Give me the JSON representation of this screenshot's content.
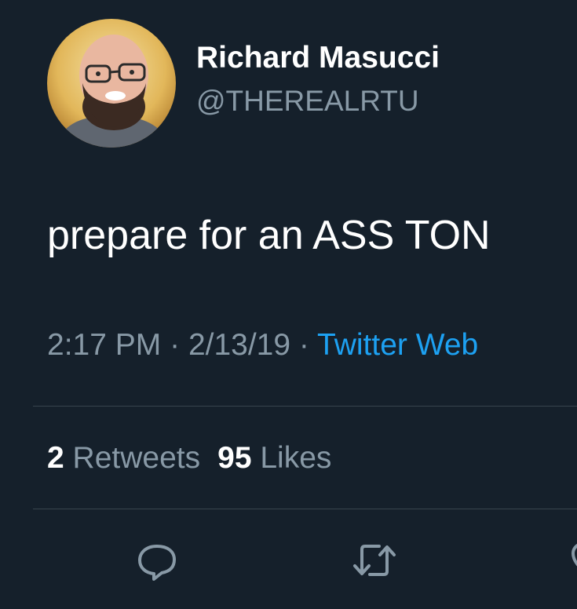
{
  "author": {
    "display_name": "Richard Masucci",
    "handle": "@THEREALRTU"
  },
  "tweet": {
    "text": "prepare for an ASS TON",
    "time": "2:17 PM",
    "date": "2/13/19",
    "separator": "·",
    "source": "Twitter Web"
  },
  "stats": {
    "retweets_count": "2",
    "retweets_label": "Retweets",
    "likes_count": "95",
    "likes_label": "Likes"
  },
  "actions": [
    {
      "icon": "reply-icon"
    },
    {
      "icon": "retweet-icon"
    },
    {
      "icon": "like-icon"
    }
  ],
  "colors": {
    "background": "#15202b",
    "primary_text": "#ffffff",
    "secondary_text": "#8899a6",
    "link": "#1da1f2",
    "divider": "#38444d"
  }
}
